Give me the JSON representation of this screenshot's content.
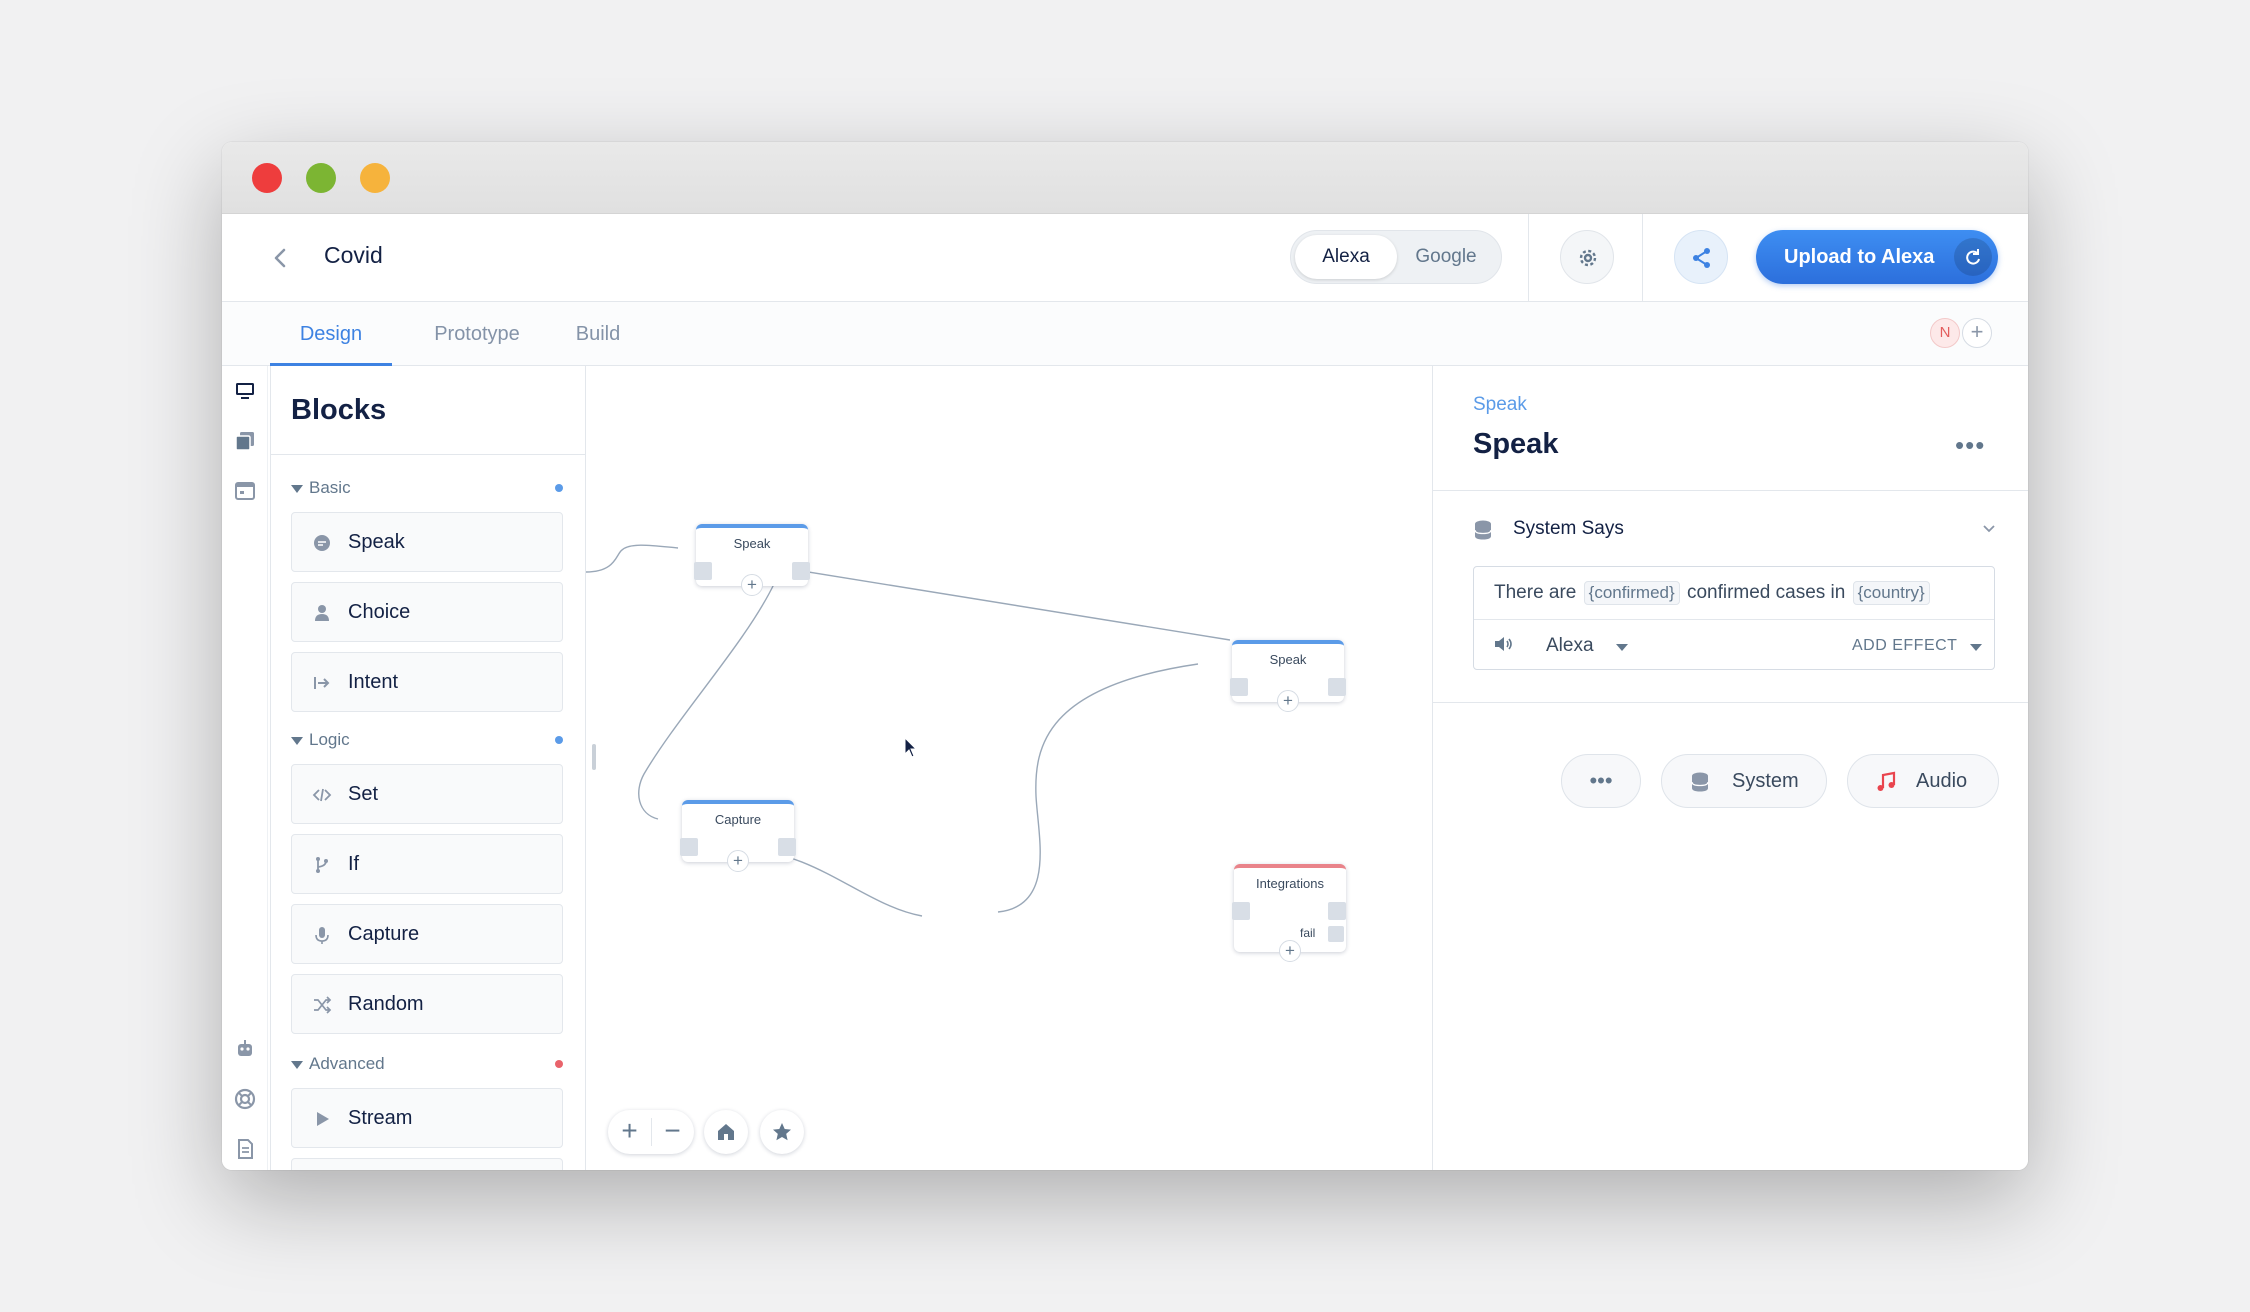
{
  "window": {
    "traffic_lights": [
      "close",
      "minimize",
      "zoom"
    ],
    "colors": {
      "close": "#ee3d3d",
      "minimize": "#7cb533",
      "zoom": "#f6b33c"
    }
  },
  "topbar": {
    "back_icon": "chevron-left-icon",
    "project_title": "Covid",
    "platforms": [
      "Alexa",
      "Google"
    ],
    "active_platform": "Alexa",
    "settings_icon": "gear-icon",
    "share_icon": "share-icon",
    "upload_label": "Upload to Alexa",
    "upload_sync_icon": "sync-icon",
    "accent_color": "#3d82e2"
  },
  "tabs": [
    {
      "label": "Design",
      "active": true
    },
    {
      "label": "Prototype",
      "active": false
    },
    {
      "label": "Build",
      "active": false
    }
  ],
  "collaborators": {
    "avatar_initial": "N",
    "add_icon": "plus-icon"
  },
  "icon_rail": {
    "top": [
      "monitor-icon",
      "library-icon",
      "calendar-icon"
    ],
    "bottom": [
      "robot-icon",
      "help-lifebuoy-icon",
      "document-icon"
    ]
  },
  "blocks_panel": {
    "title": "Blocks",
    "sections": [
      {
        "name": "Basic",
        "dot_color": "#5b9be8",
        "items": [
          {
            "label": "Speak",
            "icon": "speech-bubble-icon"
          },
          {
            "label": "Choice",
            "icon": "person-icon"
          },
          {
            "label": "Intent",
            "icon": "intent-arrow-icon"
          }
        ]
      },
      {
        "name": "Logic",
        "dot_color": "#5b9be8",
        "items": [
          {
            "label": "Set",
            "icon": "code-icon"
          },
          {
            "label": "If",
            "icon": "branch-icon"
          },
          {
            "label": "Capture",
            "icon": "microphone-icon"
          },
          {
            "label": "Random",
            "icon": "shuffle-icon"
          }
        ]
      },
      {
        "name": "Advanced",
        "dot_color": "#e9636b",
        "items": [
          {
            "label": "Stream",
            "icon": "play-icon"
          }
        ]
      }
    ]
  },
  "canvas": {
    "nodes": [
      {
        "title": "Speak",
        "accent": "#5b9be8"
      },
      {
        "title": "Speak",
        "accent": "#5b9be8"
      },
      {
        "title": "Capture",
        "accent": "#5b9be8"
      },
      {
        "title": "Integrations",
        "accent": "#e9838a",
        "fail_label": "fail"
      }
    ],
    "controls": {
      "zoom_in": "+",
      "zoom_out": "−",
      "home_icon": "home-icon",
      "star_icon": "star-icon"
    }
  },
  "editor": {
    "breadcrumb": "Speak",
    "title": "Speak",
    "more_label": "•••",
    "section_title": "System Says",
    "says_prefix": "There are",
    "var1": "{confirmed}",
    "says_middle": "confirmed cases in",
    "var2": "{country}",
    "voice": "Alexa",
    "add_effect_label": "ADD EFFECT",
    "pill_more_label": "•••",
    "pill_system_label": "System",
    "pill_audio_label": "Audio",
    "audio_icon_color": "#e9454e"
  }
}
